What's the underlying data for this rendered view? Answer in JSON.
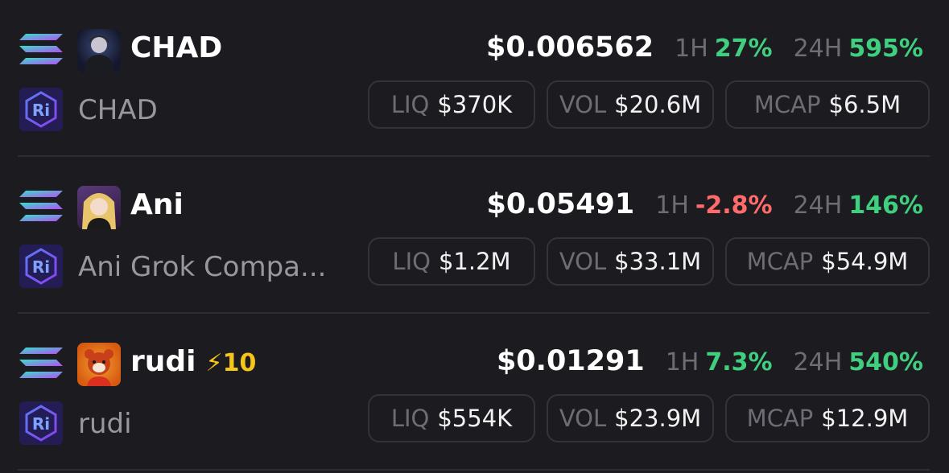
{
  "colors": {
    "background": "#1c1b20",
    "positive": "#3fcf7f",
    "negative": "#ff6b6b",
    "boost": "#f5c518",
    "muted": "#6e6d74"
  },
  "tokens": [
    {
      "symbol": "CHAD",
      "name": "CHAD",
      "boost": "",
      "price": "$0.006562",
      "h1_label": "1H",
      "h1_change": "27%",
      "h1_direction": "up",
      "h24_label": "24H",
      "h24_change": "595%",
      "h24_direction": "up",
      "liq_label": "LIQ",
      "liq_value": "$370K",
      "vol_label": "VOL",
      "vol_value": "$20.6M",
      "mcap_label": "MCAP",
      "mcap_value": "$6.5M",
      "chain_icon": "solana-icon",
      "dex_icon": "raydium-icon",
      "avatar": "chad-avatar"
    },
    {
      "symbol": "Ani",
      "name": "Ani Grok Compa...",
      "boost": "",
      "price": "$0.05491",
      "h1_label": "1H",
      "h1_change": "-2.8%",
      "h1_direction": "down",
      "h24_label": "24H",
      "h24_change": "146%",
      "h24_direction": "up",
      "liq_label": "LIQ",
      "liq_value": "$1.2M",
      "vol_label": "VOL",
      "vol_value": "$33.1M",
      "mcap_label": "MCAP",
      "mcap_value": "$54.9M",
      "chain_icon": "solana-icon",
      "dex_icon": "raydium-icon",
      "avatar": "ani-avatar"
    },
    {
      "symbol": "rudi",
      "name": "rudi",
      "boost": "⚡10",
      "price": "$0.01291",
      "h1_label": "1H",
      "h1_change": "7.3%",
      "h1_direction": "up",
      "h24_label": "24H",
      "h24_change": "540%",
      "h24_direction": "up",
      "liq_label": "LIQ",
      "liq_value": "$554K",
      "vol_label": "VOL",
      "vol_value": "$23.9M",
      "mcap_label": "MCAP",
      "mcap_value": "$12.9M",
      "chain_icon": "solana-icon",
      "dex_icon": "raydium-icon",
      "avatar": "rudi-avatar"
    }
  ]
}
